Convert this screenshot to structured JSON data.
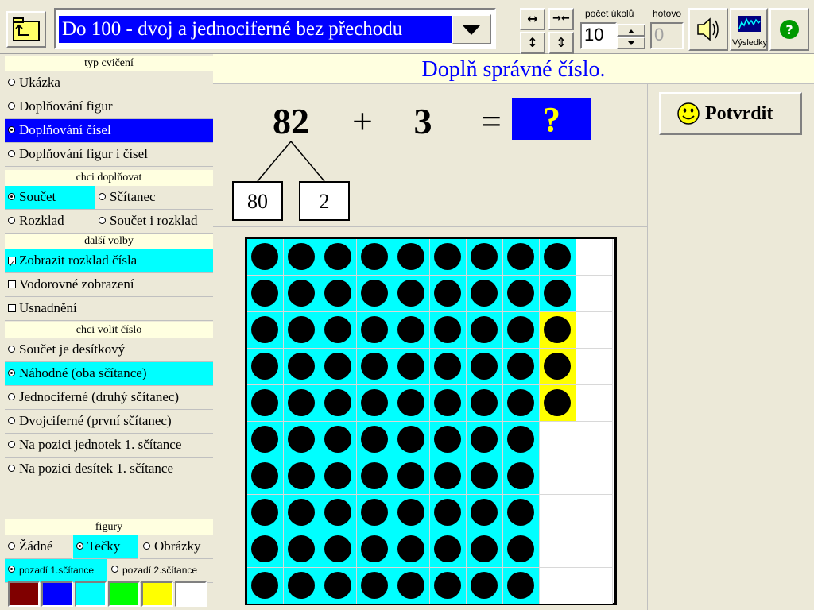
{
  "toolbar": {
    "exercise_title": "Do 100 - dvoj a jednociferné bez přechodu",
    "tasks_label": "počet úkolů",
    "tasks_value": "10",
    "done_label": "hotovo",
    "done_value": "0",
    "results_label": "Výsledky",
    "arrow_expand_h": "↔",
    "arrow_shrink_h": "→←",
    "arrow_expand_v": "↕",
    "arrow_shrink_v": "⇕"
  },
  "left_panel": {
    "exercise_type": {
      "header": "typ cvičení",
      "options": [
        "Ukázka",
        "Doplňování figur",
        "Doplňování čísel",
        "Doplňování figur i čísel"
      ],
      "selected": "Doplňování čísel"
    },
    "fill_in": {
      "header": "chci doplňovat",
      "options": [
        "Součet",
        "Sčítanec",
        "Rozklad",
        "Součet i rozklad"
      ],
      "selected": "Součet"
    },
    "more_options": {
      "header": "další volby",
      "options": [
        "Zobrazit rozklad čísla",
        "Vodorovné zobrazení",
        "Usnadnění"
      ],
      "checked": [
        "Zobrazit rozklad čísla"
      ]
    },
    "choose_number": {
      "header": "chci volit číslo",
      "options": [
        "Součet je desítkový",
        "Náhodné (oba sčítance)",
        "Jednociferné (druhý sčítanec)",
        "Dvojciferné (první sčítanec)",
        "Na pozici jednotek 1. sčítance",
        "Na pozici desítek 1. sčítance"
      ],
      "selected": "Náhodné (oba sčítance)"
    },
    "figures": {
      "header": "figury",
      "options": [
        "Žádné",
        "Tečky",
        "Obrázky"
      ],
      "selected": "Tečky",
      "background_options": [
        "pozadí 1.sčítance",
        "pozadí 2.sčítance"
      ],
      "background_selected": "pozadí 1.sčítance",
      "colors": [
        "#800000",
        "#0000ff",
        "#00ffff",
        "#00ff00",
        "#ffff00",
        "#ffffff"
      ]
    }
  },
  "main": {
    "instruction": "Doplň správné číslo.",
    "equation": {
      "a": "82",
      "plus": "+",
      "b": "3",
      "equals": "=",
      "answer": "?"
    },
    "decomposition": [
      "80",
      "2"
    ],
    "confirm_label": "Potvrdit",
    "grid": {
      "rows": 10,
      "cols": 10,
      "first_addend": 82,
      "second_addend": 3,
      "first_color": "#00ffff",
      "second_color": "#ffff00"
    }
  }
}
